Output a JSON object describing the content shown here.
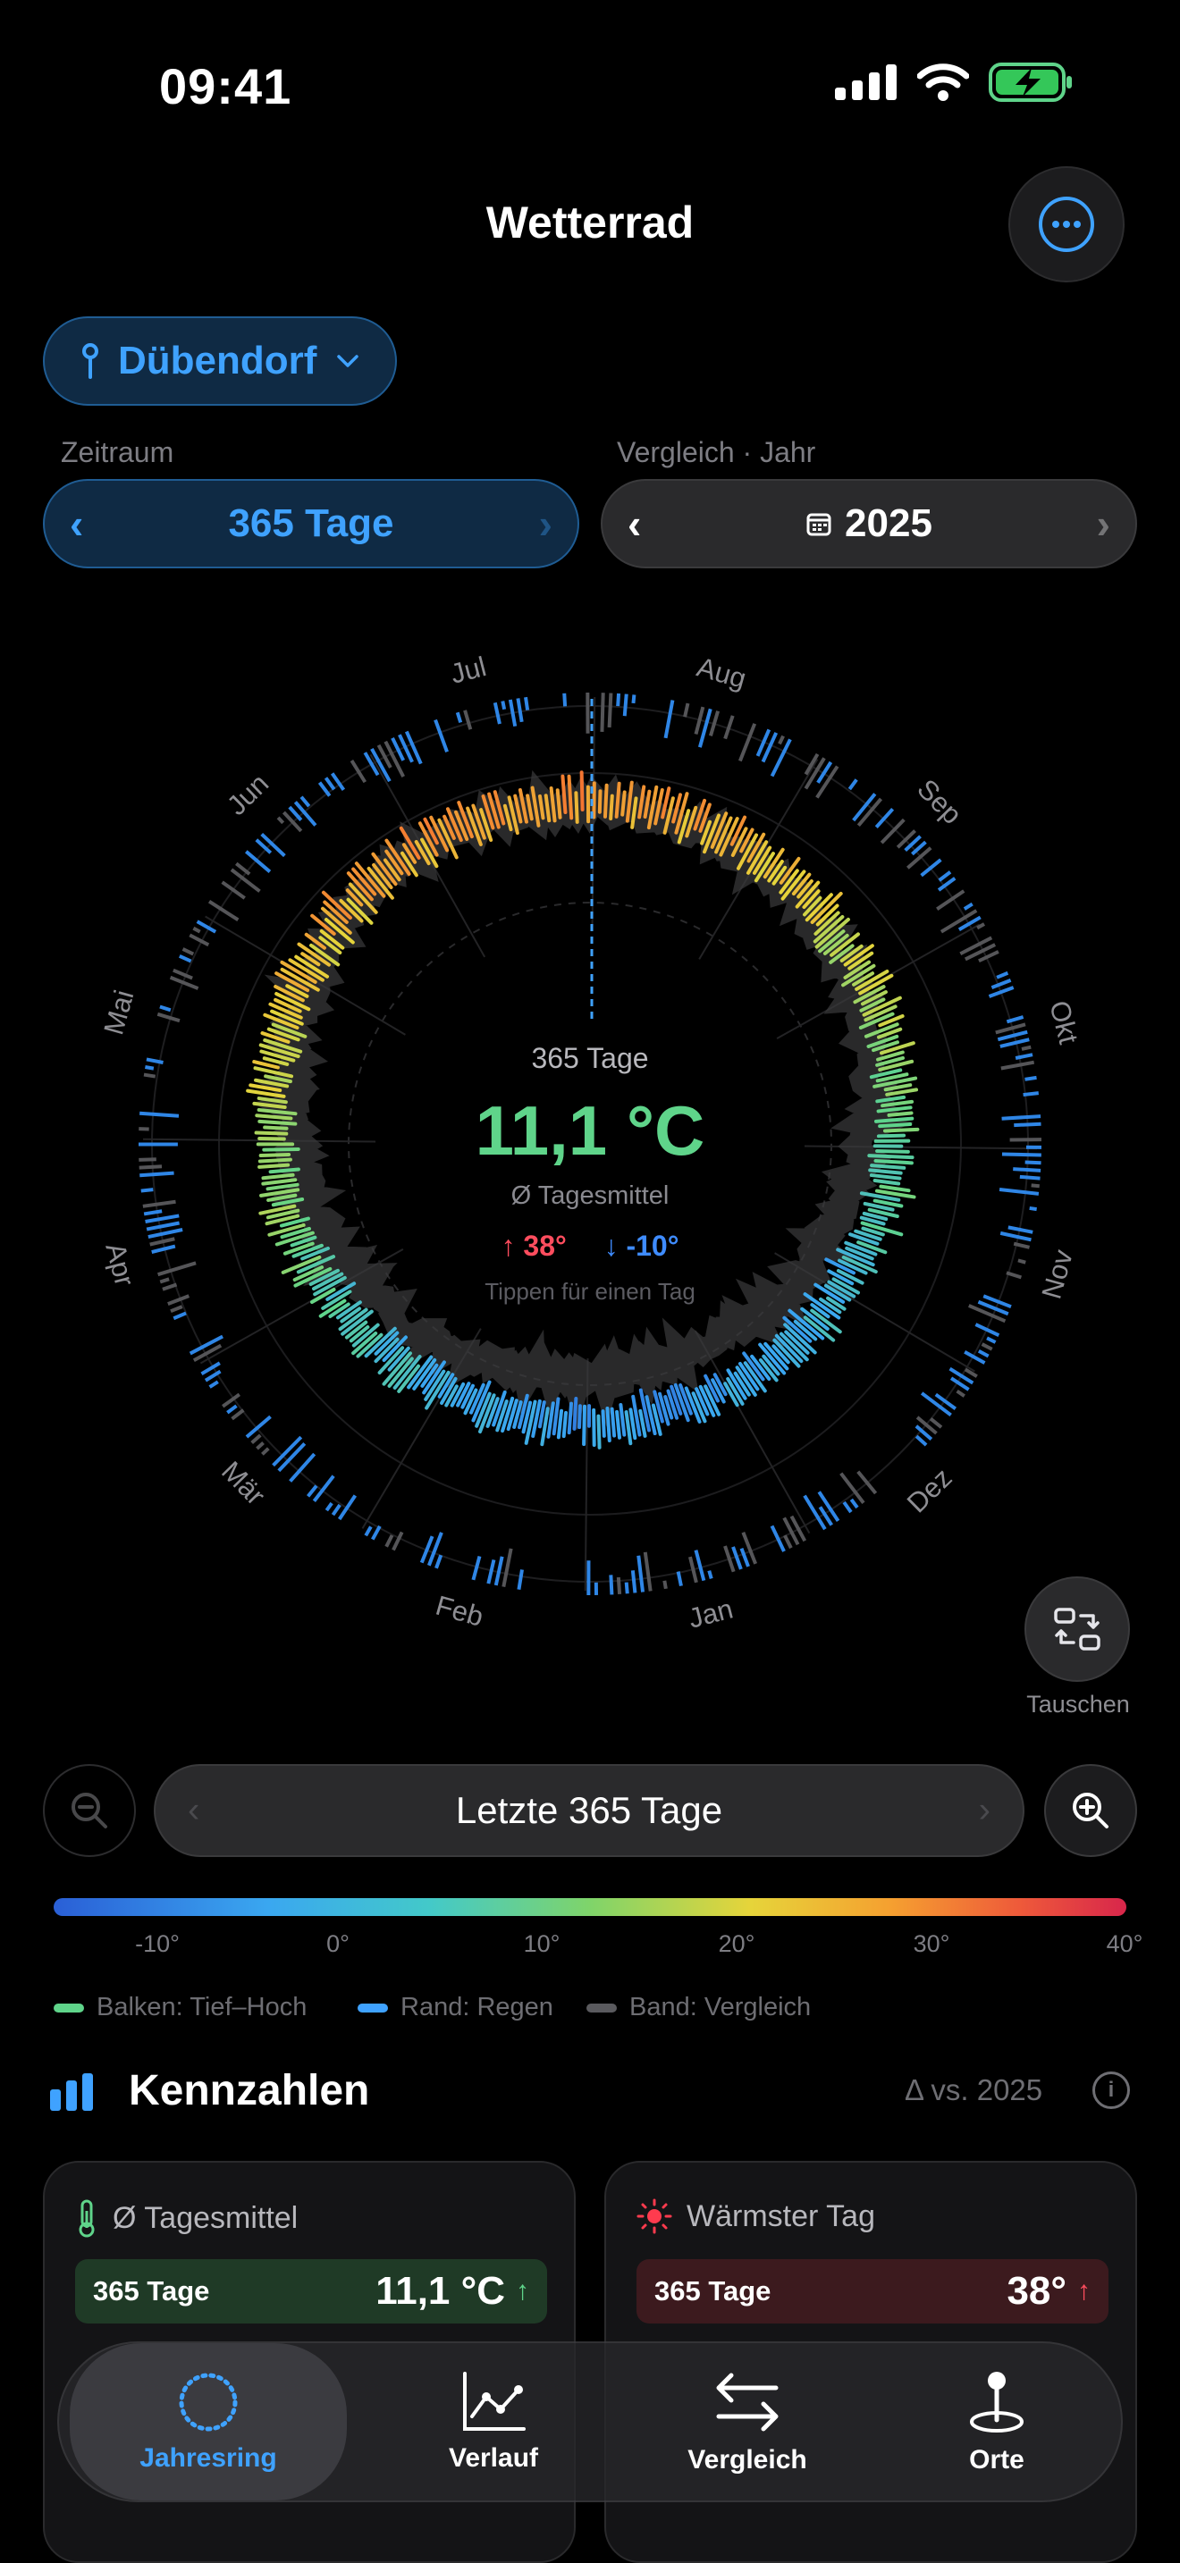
{
  "status": {
    "time": "09:41"
  },
  "header": {
    "title": "Wetterrad",
    "more_icon": "ellipsis-circle-icon"
  },
  "location": {
    "name": "Dübendorf",
    "icon": "pin-icon"
  },
  "period": {
    "label": "Zeitraum",
    "value": "365 Tage"
  },
  "compare": {
    "label": "Vergleich · Jahr",
    "value": "2025",
    "icon": "calendar-icon"
  },
  "wheel": {
    "months": [
      "Jan",
      "Feb",
      "Mär",
      "Apr",
      "Mai",
      "Jun",
      "Jul",
      "Aug",
      "Sep",
      "Okt",
      "Nov",
      "Dez"
    ],
    "center": {
      "period": "365 Tage",
      "temp": "11,1 °C",
      "subtitle": "Ø Tagesmittel",
      "max": "↑ 38°",
      "min": "↓ -10°",
      "hint": "Tippen für einen Tag"
    },
    "swap_label": "Tauschen"
  },
  "range": {
    "label": "Letzte 365 Tage"
  },
  "scale": {
    "ticks": [
      "-10°",
      "0°",
      "10°",
      "20°",
      "30°",
      "40°"
    ],
    "colors": {
      "cold": "#2a5fd6",
      "mild": "#7fd46a",
      "warm": "#f5a030",
      "hot": "#d8264b"
    }
  },
  "legend": [
    {
      "label": "Balken: Tief–Hoch",
      "color": "#5fd48a"
    },
    {
      "label": "Rand: Regen",
      "color": "#3fa2ff"
    },
    {
      "label": "Band: Vergleich",
      "color": "#5a5a5e"
    }
  ],
  "kennzahlen": {
    "title": "Kennzahlen",
    "delta": "Δ vs. 2025",
    "cards": [
      {
        "title": "Ø Tagesmittel",
        "row_label": "365 Tage",
        "value": "11,1 °C",
        "icon": "thermometer-icon"
      },
      {
        "title": "Wärmster Tag",
        "row_label": "365 Tage",
        "value": "38°",
        "icon": "sun-icon"
      }
    ]
  },
  "tabs": [
    {
      "label": "Jahresring",
      "icon": "ring-icon",
      "active": true
    },
    {
      "label": "Verlauf",
      "icon": "chart-line-icon",
      "active": false
    },
    {
      "label": "Vergleich",
      "icon": "arrows-swap-icon",
      "active": false
    },
    {
      "label": "Orte",
      "icon": "location-pin-icon",
      "active": false
    }
  ]
}
